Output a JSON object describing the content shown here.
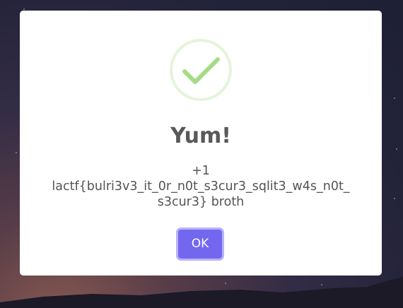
{
  "dialog": {
    "icon": "success-check-icon",
    "title": "Yum!",
    "message_lines": [
      "+1",
      "lactf{bulri3v3_it_0r_n0t_s3cur3_sqlit3_w4s_n0t_",
      "s3cur3} broth"
    ],
    "ok_label": "OK"
  },
  "colors": {
    "accent": "#7367f0",
    "success": "#a5dc86",
    "success_ring": "rgba(165,220,134,0.3)",
    "title": "#595959",
    "text": "#545454"
  }
}
